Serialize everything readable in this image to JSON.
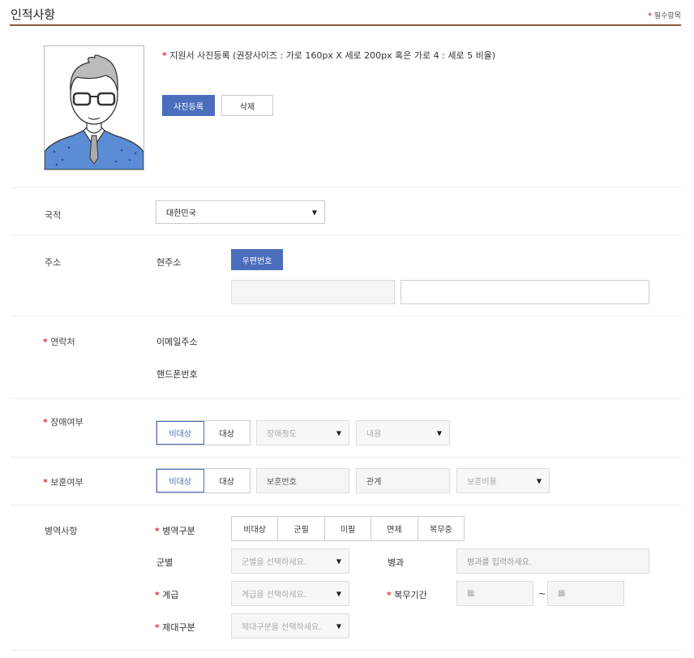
{
  "header": {
    "title": "인적사항",
    "required_note": "필수항목"
  },
  "photo": {
    "instruction": "지원서 사진등록 (권장사이즈 : 가로 160px X 세로 200px 혹은 가로 4 : 세로 5 비율)",
    "register_button": "사진등록",
    "delete_button": "삭제"
  },
  "nationality": {
    "label": "국적",
    "value": "대한민국"
  },
  "address": {
    "label": "주소",
    "sub_label": "현주소",
    "postcode_button": "우편번호",
    "postcode_value": "",
    "detail_value": ""
  },
  "contact": {
    "label": "연락처",
    "email_label": "이메일주소",
    "phone_label": "핸드폰번호"
  },
  "disability": {
    "label": "장애여부",
    "options": [
      "비대상",
      "대상"
    ],
    "selected": "비대상",
    "grade_placeholder": "장애정도",
    "content_placeholder": "내용"
  },
  "veteran": {
    "label": "보훈여부",
    "options": [
      "비대상",
      "대상"
    ],
    "selected": "비대상",
    "number_placeholder": "보훈번호",
    "relation_placeholder": "관계",
    "ratio_placeholder": "보훈비율"
  },
  "military": {
    "label": "병역사항",
    "type_label": "병역구분",
    "type_options": [
      "비대상",
      "군필",
      "미필",
      "면제",
      "복무중"
    ],
    "branch_label": "군별",
    "branch_placeholder": "군별을 선택하세요.",
    "specialty_label": "병과",
    "specialty_placeholder": "병과를 입력하세요.",
    "rank_label": "계급",
    "rank_placeholder": "계급을 선택하세요.",
    "period_label": "복무기간",
    "period_sep": "~",
    "discharge_label": "제대구분",
    "discharge_placeholder": "제대구분을 선택하세요."
  },
  "colors": {
    "accent": "#4a6dbc",
    "required": "#d33333",
    "header_line": "#8a5a3c"
  }
}
